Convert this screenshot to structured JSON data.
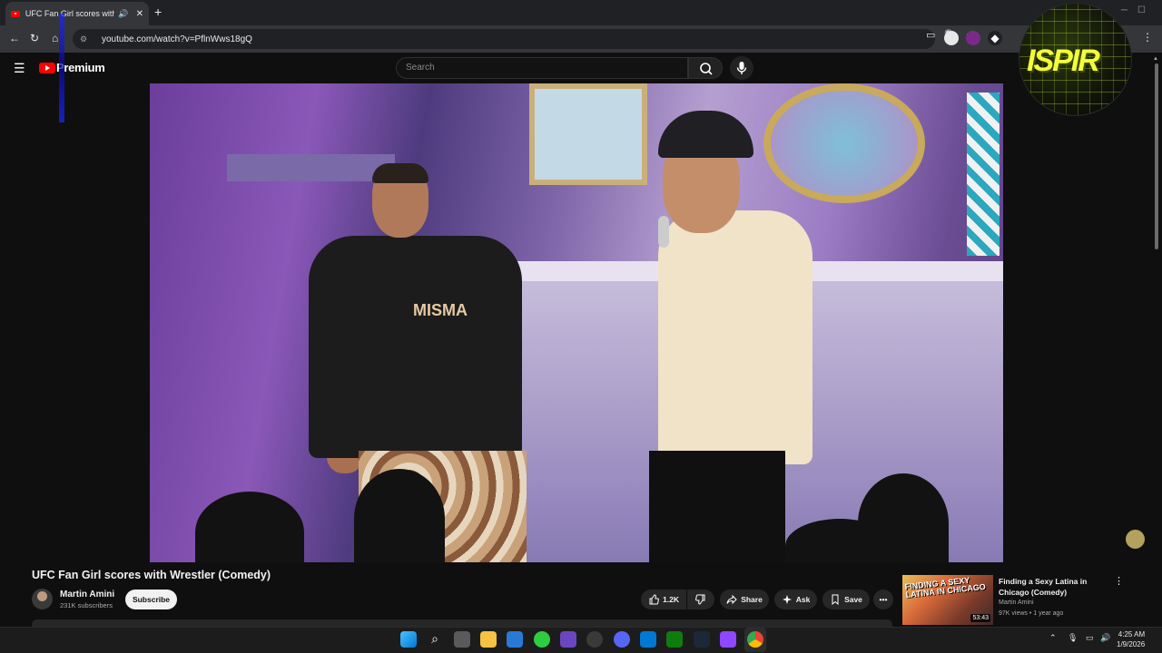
{
  "browser": {
    "tab_title": "UFC Fan Girl scores with Wrestler (Comedy)",
    "new_tab": "+",
    "url": "youtube.com/watch?v=PflnWws18gQ"
  },
  "youtube": {
    "brand": "Premium",
    "search_placeholder": "Search"
  },
  "overlay": {
    "logo_text": "ISPIR"
  },
  "video": {
    "title": "UFC Fan Girl scores with Wrestler (Comedy)",
    "channel": "Martin Amini",
    "subscribers": "231K subscribers",
    "subscribe_label": "Subscribe",
    "likes": "1.2K",
    "share_label": "Share",
    "ask_label": "Ask",
    "save_label": "Save"
  },
  "recommendation": {
    "thumb_text": "FINDING A SEXY LATINA IN CHICAGO",
    "duration": "53:43",
    "title": "Finding a Sexy Latina in Chicago (Comedy)",
    "channel": "Martin Amini",
    "meta": "97K views • 1 year ago"
  },
  "taskbar": {
    "time": "4:25 AM",
    "date": "1/9/2026"
  },
  "colors": {
    "youtube_red": "#ff0000",
    "bg": "#0f0f0f",
    "pill": "#272727",
    "taskbar": "#1c1c1c"
  }
}
